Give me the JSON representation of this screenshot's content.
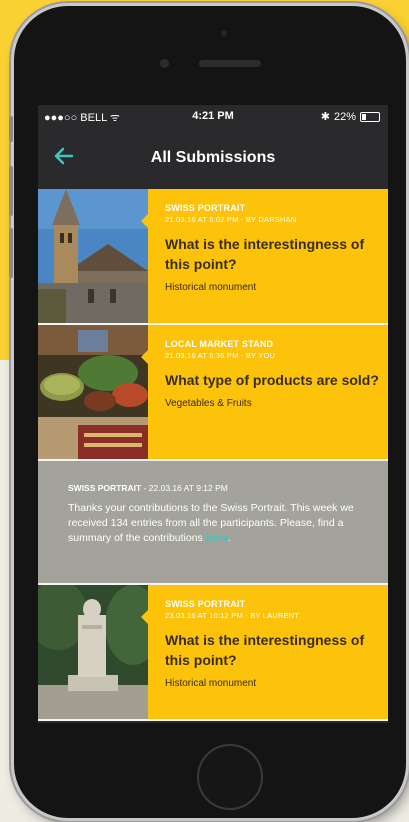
{
  "status_bar": {
    "carrier": "●●●○○ BELL ᯤ",
    "time": "4:21 PM",
    "battery": "22%",
    "bluetooth": "bluetooth-icon",
    "battery_level": 0.22
  },
  "header": {
    "title": "All Submissions",
    "back_icon": "arrow-left-icon"
  },
  "cards": [
    {
      "category": "SWISS PORTRAIT",
      "meta": "21.03.16 AT 6:02 PM - BY DARSHAN",
      "question": "What is the interestingness of this point?",
      "answer": "Historical monument",
      "photo": "church-photo"
    },
    {
      "category": "LOCAL MARKET STAND",
      "meta": "21.03.16 AT 6:36 PM - BY YOU",
      "question": "What type of products are sold?",
      "answer": "Vegetables & Fruits",
      "photo": "market-photo"
    }
  ],
  "message": {
    "category": "SWISS PORTRAIT",
    "meta": "- 22.03.16 AT 9:12 PM",
    "text": "Thanks your contributions to the Swiss Portrait. This week we received 134 entries from all the participants. Please, find a summary of the contributions ",
    "link": "here",
    "after": "."
  },
  "cards2": [
    {
      "category": "SWISS PORTRAIT",
      "meta": "23.03.16 AT 10:12 PM - BY LAURENT",
      "question": "What is the interestingness of this point?",
      "answer": "Historical monument",
      "photo": "statue-photo"
    }
  ],
  "colors": {
    "accent": "#fdc20a",
    "link": "#3fc6c0",
    "message_bg": "#a3a29b",
    "background": "#fbd033"
  }
}
